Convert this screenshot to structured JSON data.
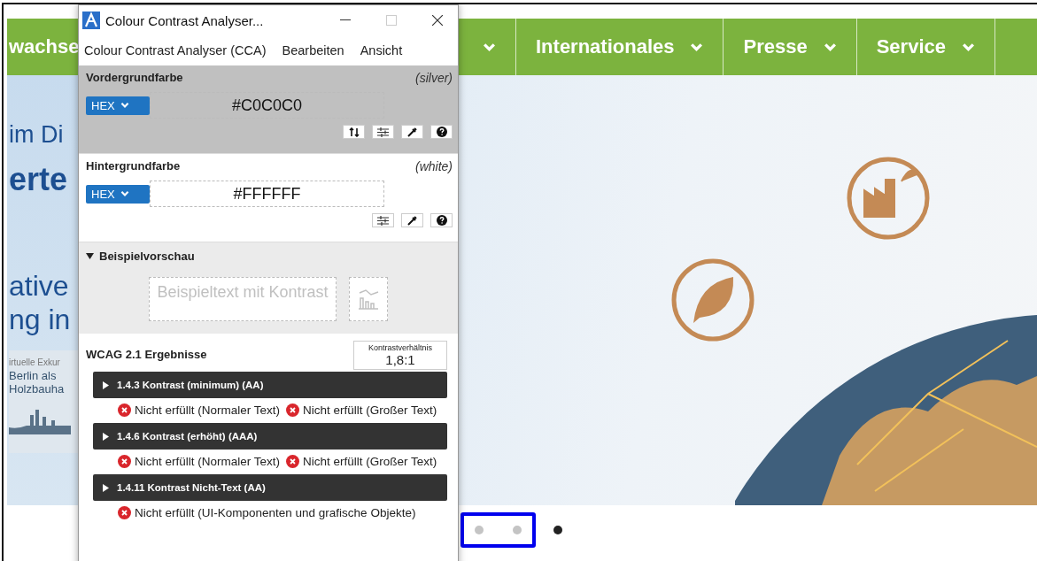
{
  "nav": [
    {
      "label": "wachse"
    },
    {
      "label": "Internationales"
    },
    {
      "label": "Presse"
    },
    {
      "label": "Service"
    }
  ],
  "hero": {
    "headlines": [
      {
        "text": "im Di",
        "kind": "medium"
      },
      {
        "text": "erte",
        "kind": "large"
      }
    ],
    "teasers": [
      {
        "text": "ative"
      },
      {
        "text": "ng in"
      }
    ],
    "tour_lines": [
      {
        "text": "irtuelle Exkur",
        "kind": "small"
      },
      {
        "text": "Berlin als",
        "kind": "normal"
      },
      {
        "text": "Holzbauha",
        "kind": "normal"
      }
    ]
  },
  "carousel": {
    "highlighted_dots": [
      {
        "selected": false
      },
      {
        "selected": false
      }
    ],
    "dots": [
      {
        "selected": true
      }
    ]
  },
  "cca_window": {
    "title": "Colour Contrast Analyser...",
    "menu": [
      "Colour Contrast Analyser (CCA)",
      "Bearbeiten",
      "Ansicht"
    ],
    "colors": [
      {
        "kind": "foreground",
        "label": "Vordergrundfarbe",
        "name": "(silver)",
        "format": "HEX",
        "value": "#C0C0C0"
      },
      {
        "kind": "background",
        "label": "Hintergrundfarbe",
        "name": "(white)",
        "format": "HEX",
        "value": "#FFFFFF"
      }
    ],
    "preview": {
      "title": "Beispielvorschau",
      "expanded": true,
      "sample": "Beispieltext mit Kontrast"
    },
    "results": {
      "title": "WCAG 2.1 Ergebnisse",
      "ratio_label": "Kontrastverhältnis",
      "ratio": "1,8:1",
      "criteria": [
        {
          "title": "1.4.3 Kontrast (minimum) (AA)",
          "expanded": false,
          "outcomes": [
            {
              "text": "Nicht erfüllt (Normaler Text)",
              "passed": false
            },
            {
              "text": "Nicht erfüllt (Großer Text)",
              "passed": false
            }
          ]
        },
        {
          "title": "1.4.6 Kontrast (erhöht) (AAA)",
          "expanded": false,
          "outcomes": [
            {
              "text": "Nicht erfüllt (Normaler Text)",
              "passed": false
            },
            {
              "text": "Nicht erfüllt (Großer Text)",
              "passed": false
            }
          ]
        },
        {
          "title": "1.4.11 Kontrast Nicht-Text (AA)",
          "expanded": false,
          "outcomes": [
            {
              "text": "Nicht erfüllt (UI-Komponenten und grafische Objekte)",
              "passed": false
            }
          ]
        }
      ]
    }
  }
}
